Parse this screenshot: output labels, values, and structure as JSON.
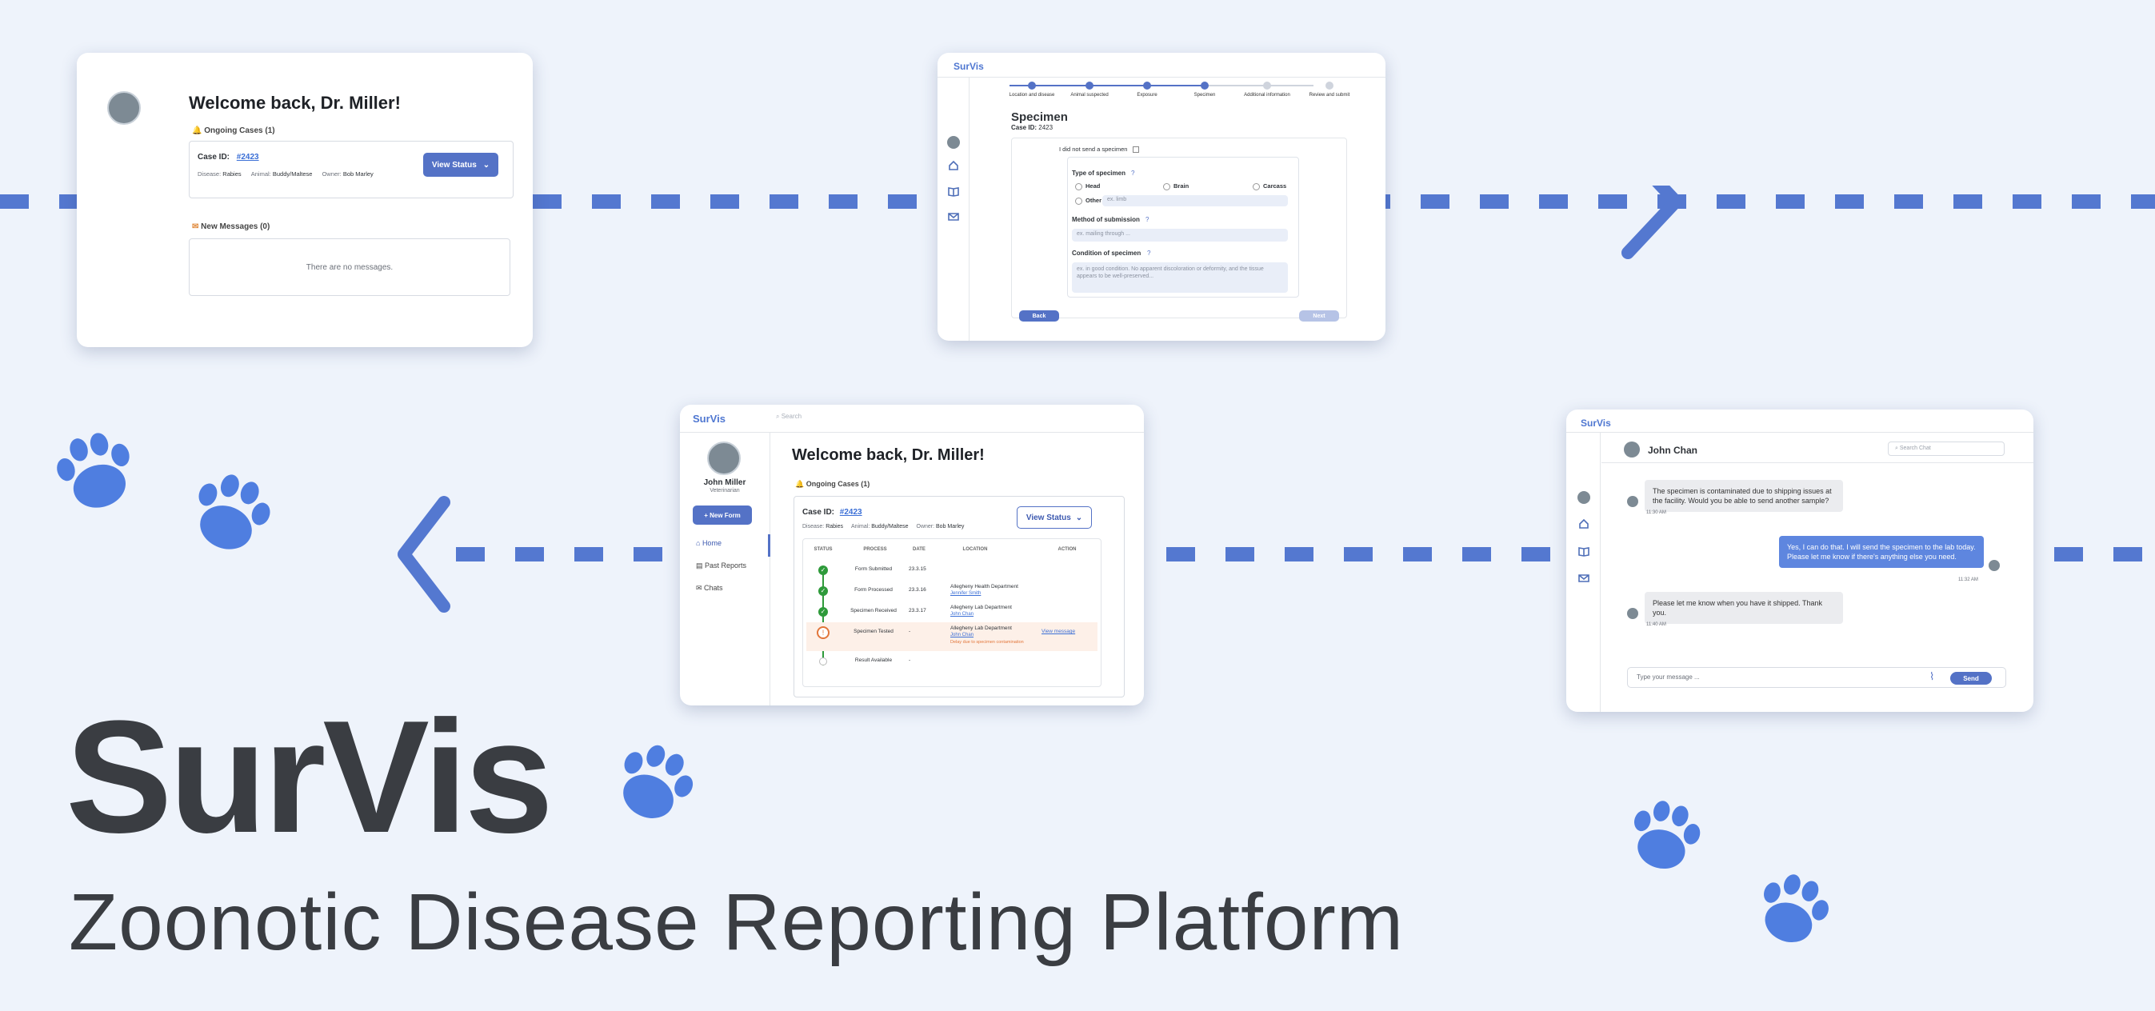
{
  "hero": {
    "title": "SurVis",
    "subtitle": "Zoonotic Disease Reporting Platform"
  },
  "colors": {
    "accent": "#4f77d1",
    "background": "#eef3fb",
    "dark_text": "#3a3d42",
    "button": "#5472c6"
  },
  "card1": {
    "welcome": "Welcome back, Dr. Miller!",
    "ongoing_header": "Ongoing Cases (1)",
    "case_label": "Case ID:",
    "case_id": "#2423",
    "disease_label": "Disease:",
    "disease": "Rabies",
    "animal_label": "Animal:",
    "animal": "Buddy/Maltese",
    "owner_label": "Owner:",
    "owner": "Bob Marley",
    "view_status": "View Status",
    "messages_header": "New Messages (0)",
    "no_messages": "There are no messages."
  },
  "card2": {
    "brand": "SurVis",
    "steps": [
      "Location and disease",
      "Animal suspected",
      "Exposure",
      "Specimen",
      "Additional information",
      "Review and submit"
    ],
    "title": "Specimen",
    "case_label": "Case ID:",
    "case_id": "2423",
    "no_specimen": "I did not send a specimen",
    "type_header": "Type of specimen",
    "opt_head": "Head",
    "opt_brain": "Brain",
    "opt_carcass": "Carcass",
    "opt_other": "Other",
    "other_placeholder": "ex. limb",
    "method_header": "Method of submission",
    "method_placeholder": "ex. mailing through ...",
    "condition_header": "Condition of specimen",
    "condition_placeholder": "ex. in good condition. No apparent discoloration or deformity, and the tissue appears to be well-preserved...",
    "back": "Back",
    "next": "Next"
  },
  "card3": {
    "brand": "SurVis",
    "search_placeholder": "Search",
    "user_name": "John Miller",
    "user_role": "Veterinarian",
    "new_form": "+ New Form",
    "nav": [
      "Home",
      "Past Reports",
      "Chats"
    ],
    "welcome": "Welcome back, Dr. Miller!",
    "ongoing_header": "Ongoing Cases (1)",
    "case_label": "Case ID:",
    "case_id": "#2423",
    "disease_label": "Disease:",
    "disease": "Rabies",
    "animal_label": "Animal:",
    "animal": "Buddy/Maltese",
    "owner_label": "Owner:",
    "owner": "Bob Marley",
    "view_status": "View Status",
    "columns": [
      "STATUS",
      "PROCESS",
      "DATE",
      "LOCATION",
      "ACTION"
    ],
    "rows": [
      {
        "process": "Form Submitted",
        "date": "23.3.15",
        "location": "",
        "person": "",
        "action": "",
        "note": "",
        "state": "done"
      },
      {
        "process": "Form Processed",
        "date": "23.3.16",
        "location": "Allegheny Health Department",
        "person": "Jennifer Smith",
        "action": "",
        "note": "",
        "state": "done"
      },
      {
        "process": "Specimen Received",
        "date": "23.3.17",
        "location": "Allegheny Lab Department",
        "person": "John Chan",
        "action": "",
        "note": "",
        "state": "done"
      },
      {
        "process": "Specimen Tested",
        "date": "-",
        "location": "Allegheny Lab Department",
        "person": "John Chan",
        "action": "View message",
        "note": "Delay due to specimen contamination",
        "state": "alert"
      },
      {
        "process": "Result Available",
        "date": "-",
        "location": "",
        "person": "",
        "action": "",
        "note": "",
        "state": "pending"
      }
    ]
  },
  "card4": {
    "brand": "SurVis",
    "contact": "John Chan",
    "search_placeholder": "Search Chat",
    "messages": [
      {
        "from": "them",
        "text": "The specimen is contaminated due to shipping issues at the facility. Would you be able to send another sample?",
        "time": "11:30 AM"
      },
      {
        "from": "me",
        "text": "Yes, I can do that. I will send the specimen to the lab today. Please let me know if there's anything else you need.",
        "time": "11:32 AM"
      },
      {
        "from": "them",
        "text": "Please let me know when you have it shipped. Thank you.",
        "time": "11:40 AM"
      }
    ],
    "input_placeholder": "Type your message ...",
    "send": "Send"
  }
}
